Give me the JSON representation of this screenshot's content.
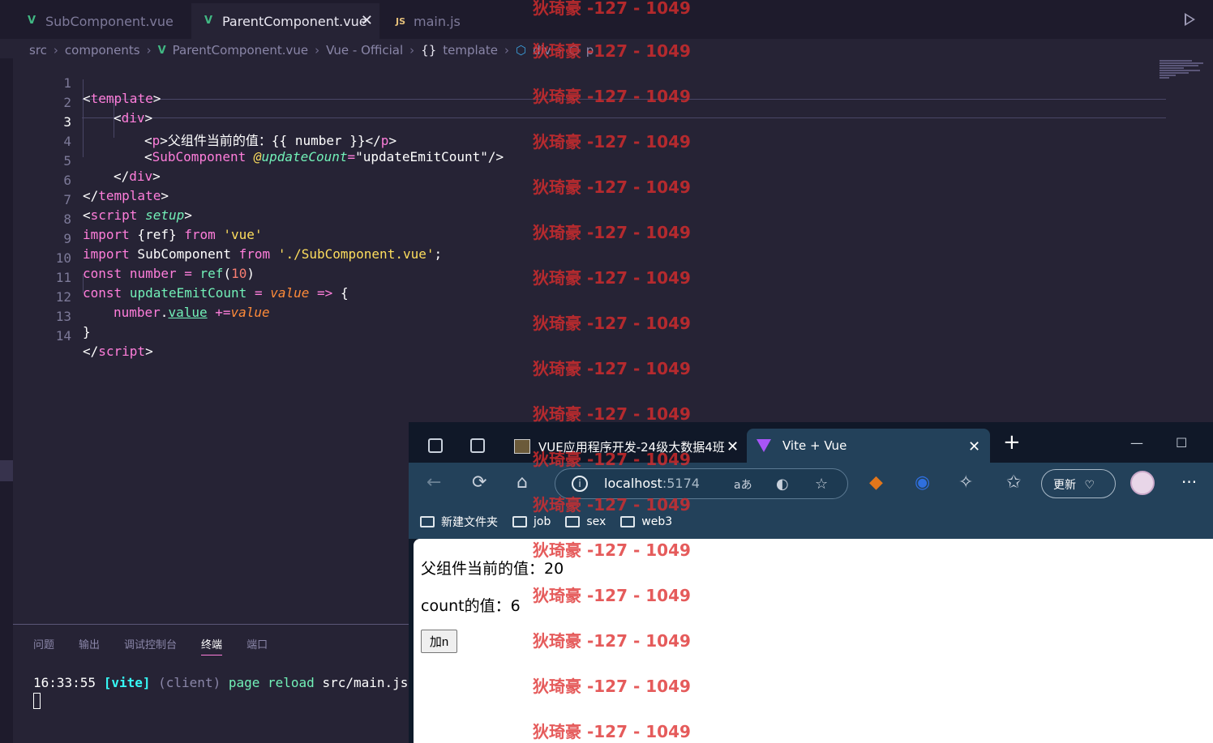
{
  "editor_tabs": [
    {
      "label": "SubComponent.vue",
      "icon": "vue-icon"
    },
    {
      "label": "ParentComponent.vue",
      "icon": "vue-icon",
      "active": true
    },
    {
      "label": "main.js",
      "icon": "js-icon"
    }
  ],
  "tab_icons": {
    "vue": "V",
    "js": "JS",
    "close": "✕"
  },
  "breadcrumb": [
    "src",
    "components",
    "ParentComponent.vue",
    "Vue - Official",
    "template",
    "div",
    "p"
  ],
  "breadcrumb_icons": {
    "template": "{}",
    "element": "⬡"
  },
  "code_lines": [
    "1",
    "2",
    "3",
    "4",
    "5",
    "6",
    "7",
    "8",
    "9",
    "10",
    "11",
    "12",
    "13",
    "14"
  ],
  "code": {
    "l1": [
      "<",
      "template",
      ">"
    ],
    "l2": [
      "<",
      "div",
      ">"
    ],
    "l3": [
      "<",
      "p",
      ">",
      "父组件当前的值：{{ number }}",
      "</",
      "p",
      ">"
    ],
    "l4": [
      "<",
      "SubComponent",
      " ",
      "@",
      "updateCount",
      "=",
      "\"updateEmitCount\"",
      "/>"
    ],
    "l5": [
      "</",
      "div",
      ">"
    ],
    "l6": [
      "</",
      "template",
      ">"
    ],
    "l7": [
      "<",
      "script",
      " ",
      "setup",
      ">"
    ],
    "l8": [
      "import",
      " {ref} ",
      "from",
      " ",
      "'vue'"
    ],
    "l9": [
      "import",
      " SubComponent ",
      "from",
      " ",
      "'./SubComponent.vue'",
      ";"
    ],
    "l10": [
      "const",
      " ",
      "number",
      " ",
      "=",
      " ",
      "ref",
      "(",
      "10",
      ")"
    ],
    "l11": [
      "const",
      " ",
      "updateEmitCount",
      " ",
      "=",
      " ",
      "value",
      " ",
      "=>",
      " {"
    ],
    "l12": [
      "number",
      ".",
      "value",
      " ",
      "+=",
      "value"
    ],
    "l13": [
      "}"
    ],
    "l14": [
      "</",
      "script",
      ">"
    ]
  },
  "panel": {
    "tabs": [
      "问题",
      "输出",
      "调试控制台",
      "终端",
      "端口"
    ],
    "active_tab": "终端",
    "terminal": {
      "time": "16:33:55",
      "tag": "[vite]",
      "client": "(client)",
      "msg1": "page",
      "msg2": "reload",
      "path": "src/main.js"
    }
  },
  "browser": {
    "tabs": [
      {
        "title": "VUE应用程序开发-24级大数据4班"
      },
      {
        "title": "Vite + Vue"
      }
    ],
    "icons": {
      "back": "←",
      "reload": "⟳",
      "home": "⌂",
      "info": "i",
      "read_aloud": "aあ",
      "favorite": "☆",
      "extensions": "✧",
      "favorites_bar": "✩",
      "more": "···",
      "new_tab": "+",
      "close": "✕",
      "minimize": "—",
      "maximize": "☐"
    },
    "address": {
      "host": "localhost",
      "port": ":5174"
    },
    "update_label": "更新",
    "bookmarks": [
      "新建文件夹",
      "job",
      "sex",
      "web3"
    ],
    "page": {
      "parent_text": "父组件当前的值：20",
      "count_text": "count的值：6",
      "button_label": "加n"
    }
  },
  "watermark": "狄琦豪 -127 - 1049",
  "colors": {
    "editor_bg": "#262335",
    "accent": "#ff7edb",
    "vue_green": "#41b883",
    "browser_chrome": "#23415a",
    "watermark": "#de2d2d"
  }
}
